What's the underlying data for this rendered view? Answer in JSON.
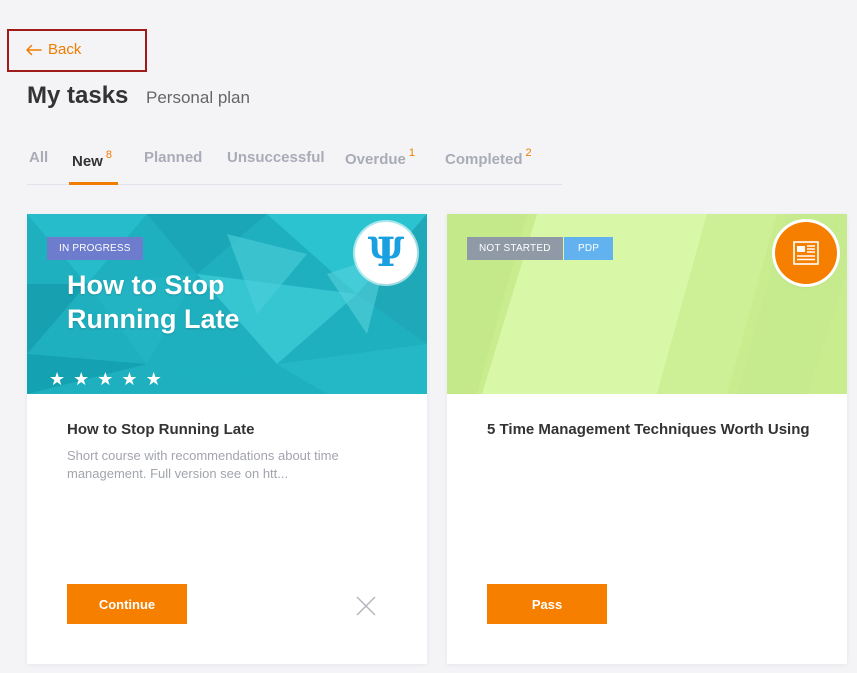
{
  "nav": {
    "back_label": "Back"
  },
  "header": {
    "title": "My tasks",
    "subtitle": "Personal plan"
  },
  "tabs": [
    {
      "label": "All",
      "count": ""
    },
    {
      "label": "New",
      "count": "8"
    },
    {
      "label": "Planned",
      "count": ""
    },
    {
      "label": "Unsuccessful",
      "count": ""
    },
    {
      "label": "Overdue",
      "count": "1"
    },
    {
      "label": "Completed",
      "count": "2"
    }
  ],
  "active_tab": "New",
  "colors": {
    "accent": "#f77f00",
    "badge_in_progress": "#6d7ccc",
    "badge_not_started": "#8f9aa6",
    "badge_pdp": "#62b2ef"
  },
  "cards": [
    {
      "status": "IN PROGRESS",
      "cover_title_line1": "How to Stop",
      "cover_title_line2": "Running Late",
      "rating_stars": 5,
      "emblem_icon": "psi-icon",
      "emblem_glyph": "Ψ",
      "title": "How to Stop Running Late",
      "description": "Short course with recommendations about time management. Full version see on htt...",
      "button_label": "Continue",
      "dismiss_icon": "close-icon"
    },
    {
      "status": "NOT STARTED",
      "tag": "PDP",
      "emblem_icon": "document-icon",
      "title": "5 Time Management Techniques Worth Using",
      "button_label": "Pass"
    }
  ]
}
